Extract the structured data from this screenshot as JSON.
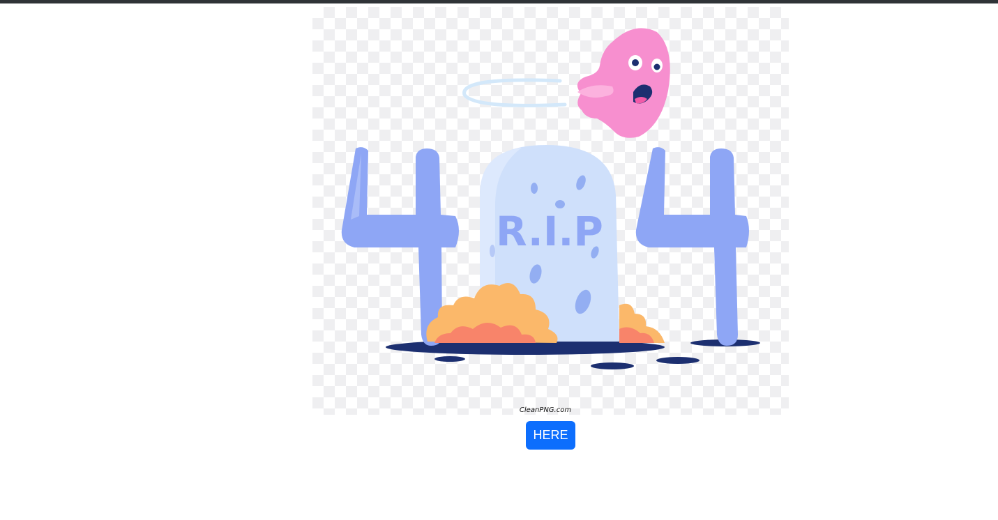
{
  "illustration": {
    "tombstone_text": "R.I.P",
    "watermark": "CleanPNG.com",
    "icon": "404-tombstone-ghost-illustration"
  },
  "actions": {
    "here_label": "HERE"
  },
  "colors": {
    "top_bar": "#2f3337",
    "button": "#0d6efd",
    "digit": "#8ea6f5",
    "tombstone": "#cfe0fb",
    "ghost": "#f78fcf",
    "bush": "#fbb86a",
    "ground": "#1c2f70"
  }
}
